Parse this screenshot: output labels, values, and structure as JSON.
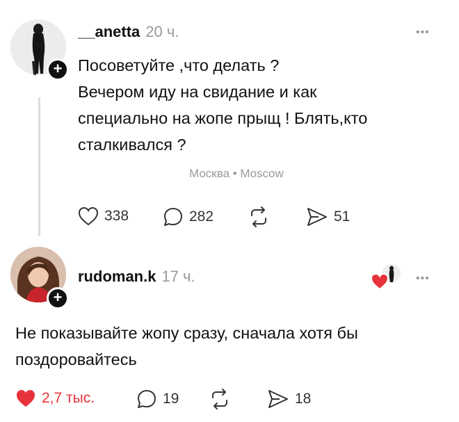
{
  "post": {
    "username": "__anetta",
    "time": "20 ч.",
    "text_lines": [
      "Посоветуйте ,что делать ?",
      "Вечером иду на свидание и как",
      "специально на жопе прыщ ! Блять,кто",
      "сталкивался ?"
    ],
    "location": "Москва • Moscow",
    "likes": "338",
    "comments": "282",
    "shares": "51"
  },
  "reply": {
    "username": "rudoman.k",
    "time": "17 ч.",
    "text_lines": [
      "Не показывайте жопу сразу, сначала хотя бы",
      "поздоровайтесь"
    ],
    "likes": "2,7 тыс.",
    "comments": "19",
    "shares": "18"
  },
  "ui": {
    "more_label": "•••",
    "plus_label": "+"
  },
  "colors": {
    "like_active": "#e8323c",
    "muted": "#999999",
    "text": "#111111"
  }
}
